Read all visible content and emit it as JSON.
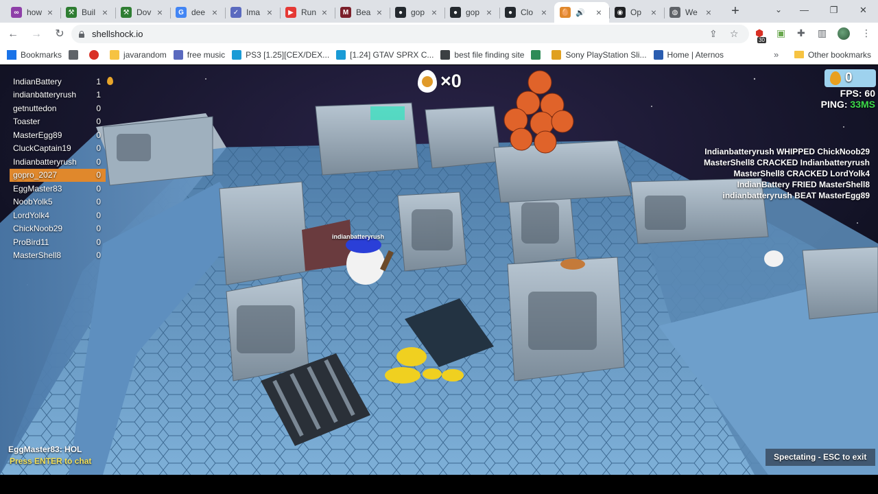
{
  "browser": {
    "tabs": [
      {
        "title": "how",
        "color": "#8e3fa8",
        "glyph": "∞"
      },
      {
        "title": "Buil",
        "color": "#2e7d32",
        "glyph": "⚒"
      },
      {
        "title": "Dov",
        "color": "#2e7d32",
        "glyph": "⚒"
      },
      {
        "title": "dee",
        "color": "#4285f4",
        "glyph": "G"
      },
      {
        "title": "Ima",
        "color": "#5a6abf",
        "glyph": "✓"
      },
      {
        "title": "Run",
        "color": "#e53935",
        "glyph": "▶"
      },
      {
        "title": "Bea",
        "color": "#7b1f2a",
        "glyph": "M"
      },
      {
        "title": "gop",
        "color": "#24292e",
        "glyph": "●"
      },
      {
        "title": "gop",
        "color": "#24292e",
        "glyph": "●"
      },
      {
        "title": "Clo",
        "color": "#24292e",
        "glyph": "●"
      },
      {
        "title": "",
        "color": "#e0882c",
        "glyph": "🥚"
      },
      {
        "title": "Op",
        "color": "#202124",
        "glyph": "◉"
      },
      {
        "title": "We",
        "color": "#5f6368",
        "glyph": "◍"
      }
    ],
    "url": "shellshock.io",
    "extension_badge": "30",
    "bookmarks": [
      {
        "label": "Bookmarks",
        "color": "#1a73e8"
      },
      {
        "label": "",
        "color": "#5f6368"
      },
      {
        "label": "",
        "color": "#d93025"
      },
      {
        "label": "javarandom",
        "color": "#f6c342"
      },
      {
        "label": "free music",
        "color": "#5a6abf"
      },
      {
        "label": "PS3 [1.25][CEX/DEX...",
        "color": "#1a9bd6"
      },
      {
        "label": "[1.24] GTAV SPRX C...",
        "color": "#1a9bd6"
      },
      {
        "label": "best file finding site",
        "color": "#3c4043"
      },
      {
        "label": "",
        "color": "#2e8b57"
      },
      {
        "label": "Sony PlayStation Sli...",
        "color": "#e0a020"
      },
      {
        "label": "Home | Aternos",
        "color": "#2a5db0"
      }
    ],
    "other_bookmarks": "Other bookmarks"
  },
  "hud": {
    "scoreboard": [
      {
        "name": "IndianBattery",
        "score": "1",
        "me": false
      },
      {
        "name": "indianbatteryrush",
        "score": "1",
        "me": false
      },
      {
        "name": "getnuttedon",
        "score": "0",
        "me": false
      },
      {
        "name": "Toaster",
        "score": "0",
        "me": false
      },
      {
        "name": "MasterEgg89",
        "score": "0",
        "me": false
      },
      {
        "name": "CluckCaptain19",
        "score": "0",
        "me": false
      },
      {
        "name": "Indianbatteryrush",
        "score": "0",
        "me": false
      },
      {
        "name": "gopro_2027",
        "score": "0",
        "me": true
      },
      {
        "name": "EggMaster83",
        "score": "0",
        "me": false
      },
      {
        "name": "NoobYolk5",
        "score": "0",
        "me": false
      },
      {
        "name": "LordYolk4",
        "score": "0",
        "me": false
      },
      {
        "name": "ChickNoob29",
        "score": "0",
        "me": false
      },
      {
        "name": "ProBird11",
        "score": "0",
        "me": false
      },
      {
        "name": "MasterShell8",
        "score": "0",
        "me": false
      }
    ],
    "kill_streak": "×0",
    "eggs": "0",
    "fps_label": "FPS: 60",
    "ping_label": "PING: ",
    "ping_value": "33MS",
    "killfeed": [
      "Indianbatteryrush WHIPPED ChickNoob29",
      "MasterShell8 CRACKED Indianbatteryrush",
      "MasterShell8 CRACKED LordYolk4",
      "IndianBattery FRIED MasterShell8",
      "indianbatteryrush BEAT MasterEgg89"
    ],
    "chat_message": "EggMaster83: HOL",
    "chat_hint": "Press ENTER to chat",
    "spectate_hint": "Spectating - ESC to exit",
    "player_nametag": "indianbatteryrush"
  },
  "colors": {
    "accent_orange": "#e0882c",
    "ping_green": "#3ddc4a",
    "chat_hint_yellow": "#f3e15a",
    "egg_panel_blue": "#9ed2ee"
  }
}
